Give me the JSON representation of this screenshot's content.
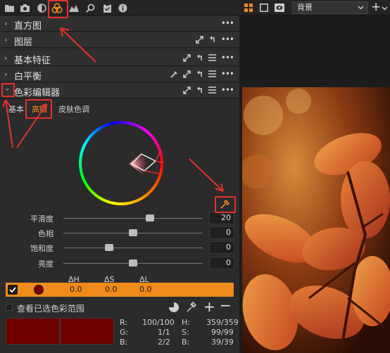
{
  "toolbar": {
    "icons": [
      "folder-icon",
      "camera-icon",
      "color-lens-icon",
      "color-circles-icon",
      "layers-icon",
      "search-icon",
      "clipboard-icon",
      "info-icon"
    ]
  },
  "sections": {
    "histogram": "直方图",
    "layers": "图层",
    "basic_characteristics": "基本特征",
    "white_balance": "白平衡",
    "color_editor": "色彩编辑器"
  },
  "tabs": {
    "basic": "基本",
    "advanced": "高级",
    "skin_tone": "皮肤色调"
  },
  "sliders": [
    {
      "label": "平滑度",
      "value": "20",
      "level": 0.62
    },
    {
      "label": "色相",
      "value": "0",
      "level": 0.5
    },
    {
      "label": "饱和度",
      "value": "0",
      "level": 0.33
    },
    {
      "label": "亮度",
      "value": "0",
      "level": 0.5
    }
  ],
  "color_table": {
    "headers": [
      "ΔH",
      "ΔS",
      "ΔL"
    ],
    "row": {
      "checked": true,
      "swatch_color": "#7a0000",
      "dh": "0.0",
      "ds": "0.0",
      "dl": "0.0"
    }
  },
  "view_range_label": "查看已选色彩范围",
  "readout": {
    "r_label": "R:",
    "r_value": "100/100",
    "g_label": "G:",
    "g_value": "1/1",
    "b_label": "B:",
    "b_value": "2/2",
    "h_label": "H:",
    "h_value": "359/359",
    "s_label": "S:",
    "s_value": "99/99",
    "b2_label": "B:",
    "b2_value": "39/39"
  },
  "swatches": {
    "before": "#6e0000",
    "after": "#6e0000"
  },
  "viewer": {
    "layer_select": "背景"
  },
  "colors": {
    "accent": "#ef8b1a",
    "annotation": "#e8312a",
    "panel": "#2b2b2b"
  }
}
